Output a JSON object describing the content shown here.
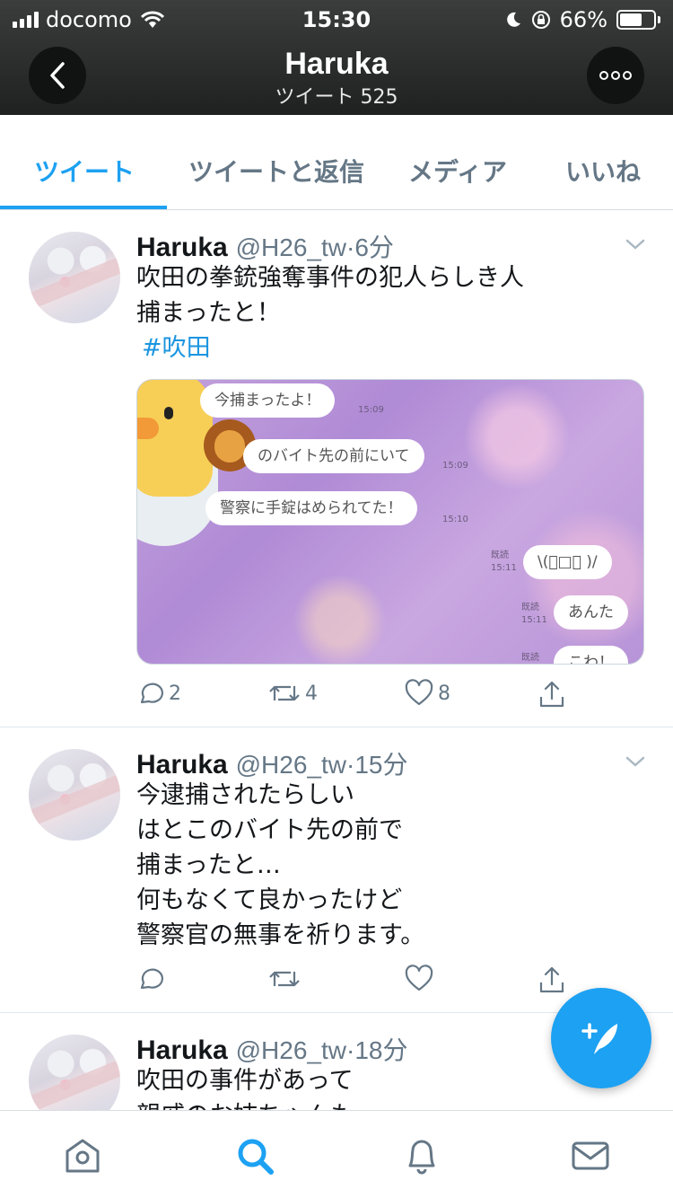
{
  "status_bar": {
    "carrier": "docomo",
    "time": "15:30",
    "battery": "66%",
    "battery_level": 0.66
  },
  "header": {
    "title": "Haruka",
    "subtitle": "ツイート 525",
    "back_icon": "chevron-left-icon",
    "more_icon": "more-dots-icon"
  },
  "tabs": [
    {
      "label": "ツイート",
      "active": true
    },
    {
      "label": "ツイートと返信",
      "active": false
    },
    {
      "label": "メディア",
      "active": false
    },
    {
      "label": "いいね",
      "active": false
    }
  ],
  "tweets": [
    {
      "name": "Haruka",
      "handle": "@H26_tw",
      "time": "6分",
      "lines": [
        "吹田の拳銃強奪事件の犯人らしき人",
        "捕まったと！"
      ],
      "hashtag": "#吹田",
      "media": {
        "messages": [
          {
            "text": "今捕まったよ！",
            "time": "15:09"
          },
          {
            "text": "のバイト先の前にいて",
            "time": "15:09"
          },
          {
            "text": "警察に手錠はめられてた！",
            "time": "15:10"
          },
          {
            "text": "\\(ﾟ□ﾟ )/",
            "read": "既読",
            "time": "15:11"
          },
          {
            "text": "あんた",
            "read": "既読",
            "time": "15:11"
          },
          {
            "text": "こわ！",
            "read": "既読"
          }
        ]
      },
      "replies": "2",
      "retweets": "4",
      "likes": "8"
    },
    {
      "name": "Haruka",
      "handle": "@H26_tw",
      "time": "15分",
      "lines": [
        "今逮捕されたらしい",
        "はとこのバイト先の前で",
        "捕まったと…",
        "何もなくて良かったけど",
        "警察官の無事を祈ります。"
      ]
    },
    {
      "name": "Haruka",
      "handle": "@H26_tw",
      "time": "18分",
      "lines": [
        "吹田の事件があって",
        "親戚のお姉ちゃんも"
      ]
    }
  ],
  "bottom_nav": [
    {
      "name": "home-icon",
      "active": false
    },
    {
      "name": "search-icon",
      "active": true
    },
    {
      "name": "bell-icon",
      "active": false
    },
    {
      "name": "mail-icon",
      "active": false
    }
  ],
  "colors": {
    "accent": "#1da1f2",
    "header_bg": "#2b2e2d",
    "secondary_text": "#657786"
  }
}
